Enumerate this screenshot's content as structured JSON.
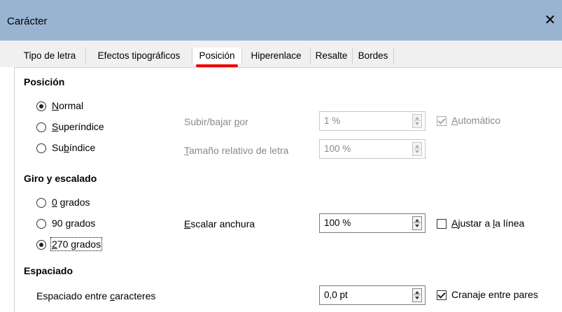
{
  "window": {
    "title": "Carácter",
    "close_glyph": "✕"
  },
  "tabs": [
    {
      "label": "Tipo de letra"
    },
    {
      "label": "Efectos tipográficos"
    },
    {
      "label": "Posición"
    },
    {
      "label": "Hiperenlace"
    },
    {
      "label": "Resalte"
    },
    {
      "label": "Bordes"
    }
  ],
  "accent_color": "#e00000",
  "position": {
    "heading": "Posición",
    "options": [
      {
        "pre": "",
        "ul": "N",
        "post": "ormal",
        "checked": true
      },
      {
        "pre": "",
        "ul": "S",
        "post": "uperíndice",
        "checked": false
      },
      {
        "pre": "Su",
        "ul": "b",
        "post": "índice",
        "checked": false
      }
    ],
    "raise_label": {
      "pre": "Subir/bajar ",
      "ul": "p",
      "post": "or"
    },
    "raise_value": "1 %",
    "size_label": {
      "pre": "",
      "ul": "T",
      "post": "amaño relativo de letra"
    },
    "size_value": "100 %",
    "auto_label": {
      "pre": "",
      "ul": "A",
      "post": "utomático"
    },
    "auto_checked": true
  },
  "rotation": {
    "heading": "Giro y escalado",
    "options": [
      {
        "pre": "",
        "ul": "0",
        "post": " grados",
        "checked": false
      },
      {
        "pre": "90 ",
        "ul": "g",
        "post": "rados",
        "checked": false
      },
      {
        "pre": "",
        "ul": "2",
        "post": "70 grados",
        "checked": true
      }
    ],
    "scale_label": {
      "pre": "",
      "ul": "E",
      "post": "scalar anchura"
    },
    "scale_value": "100 %",
    "fit_label": {
      "pre": "",
      "ul": "A",
      "post": "justar a ",
      "ul2": "l",
      "post2": "a línea"
    },
    "fit_checked": false
  },
  "spacing": {
    "heading": "Espaciado",
    "label": {
      "pre": "Espaciado entre ",
      "ul": "c",
      "post": "aracteres"
    },
    "value": "0,0 pt",
    "kerning_label": "Cranaje entre pares",
    "kerning_checked": true
  }
}
